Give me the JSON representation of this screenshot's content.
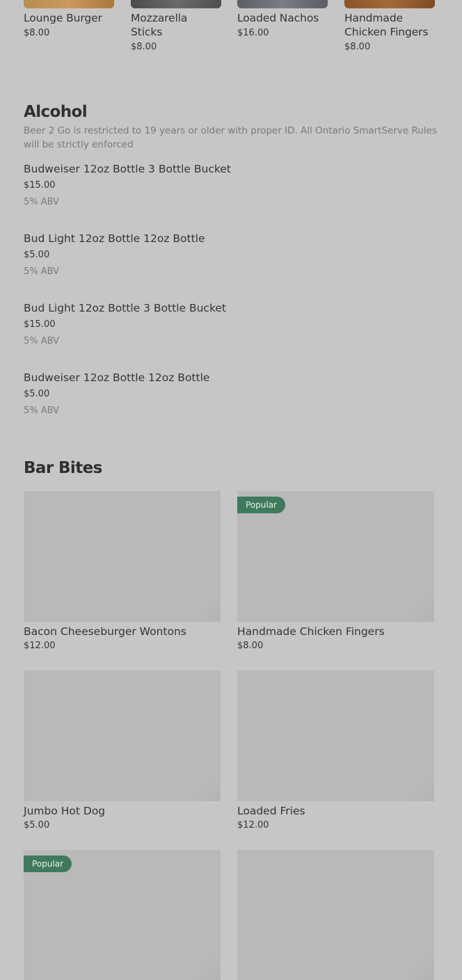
{
  "carousel": [
    {
      "name": "Lounge Burger",
      "price": "$8.00",
      "thumb_color": "#b58a52"
    },
    {
      "name": "Mozzarella Sticks",
      "price": "$8.00",
      "thumb_color": "#5a5a5a"
    },
    {
      "name": "Loaded Nachos",
      "price": "$16.00",
      "thumb_color": "#6b6e73"
    },
    {
      "name": "Handmade Chicken Fingers",
      "price": "$8.00",
      "thumb_color": "#8c5a2e"
    }
  ],
  "alcohol": {
    "title": "Alcohol",
    "description": "Beer 2 Go is restricted to 19 years or older with proper ID. All Ontario SmartServe Rules will be strictly enforced",
    "items": [
      {
        "name": "Budweiser 12oz Bottle 3 Bottle Bucket",
        "price": "$15.00",
        "note": "5% ABV"
      },
      {
        "name": "Bud Light 12oz Bottle 12oz Bottle",
        "price": "$5.00",
        "note": "5% ABV"
      },
      {
        "name": "Bud Light 12oz Bottle 3 Bottle Bucket",
        "price": "$15.00",
        "note": "5% ABV"
      },
      {
        "name": "Budweiser 12oz Bottle 12oz Bottle",
        "price": "$5.00",
        "note": "5% ABV"
      }
    ]
  },
  "bar_bites": {
    "title": "Bar Bites",
    "badge_label": "Popular",
    "items": [
      {
        "name": "Bacon Cheeseburger Wontons",
        "price": "$12.00"
      },
      {
        "name": "Handmade Chicken Fingers",
        "price": "$8.00"
      },
      {
        "name": "Jumbo Hot Dog",
        "price": "$5.00"
      },
      {
        "name": "Loaded Fries",
        "price": "$12.00"
      }
    ]
  }
}
